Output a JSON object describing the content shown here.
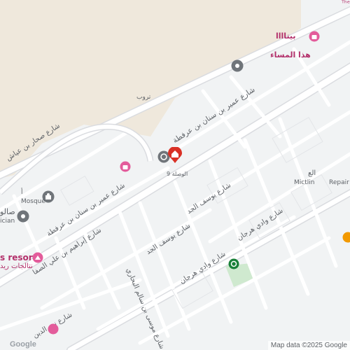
{
  "streets": {
    "sahar": "شارع صحار بن عياش",
    "umair_main": "شارع عمير بن سنان بن عرفطة",
    "umair_lower": "شارع عمير بن سنان بن عرفطة",
    "yusuf_upper": "شارع يوسف الجد",
    "yusuf_lower": "شارع يوسف الجد",
    "wadi_upper": "شارع وادي هرجان",
    "wadi_lower": "شارع وادي هرجان",
    "musa": "شارع موسى بن سالم البحاري",
    "ibrahim": "شارع إبراهيم بن علي الصفا",
    "bottom": "شارع نور الدين"
  },
  "pois": {
    "bayta": "بيتاااا",
    "hatha_al_masa": "هذا المساء",
    "top_corner": "ᵀʰᵉ",
    "small_label": "تروب",
    "selected_label": "الوصلة 9",
    "mosque": "Mosque",
    "mosque_arabic": "أ",
    "left_arabic": "صالو",
    "ician": "ician",
    "resorts": "s resorts",
    "resorts_arabic": "نتالجات ريد",
    "mictlin": "Mictlin",
    "repair": "Repair re",
    "right_arabic": "الع"
  },
  "branding": {
    "logo": "Google",
    "attribution": "Map data ©2025 Google"
  },
  "colors": {
    "background": "#f1f3f4",
    "road": "#ffffff",
    "sand": "#efe8dc",
    "park": "#cfe9cf",
    "poi_pink": "#e35c9b",
    "selected_red": "#d93025"
  }
}
